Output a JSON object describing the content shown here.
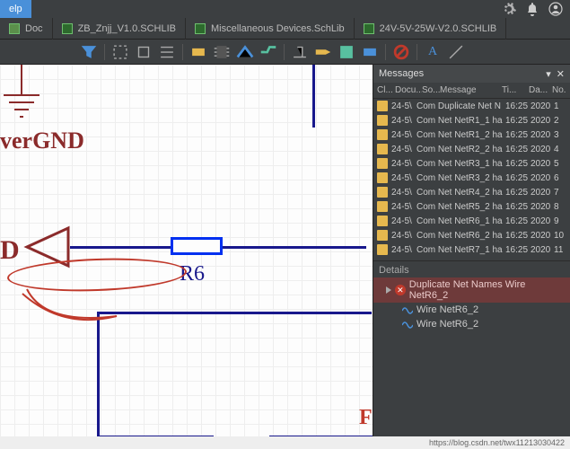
{
  "menu": {
    "help": "elp"
  },
  "tabs": [
    {
      "label": "Doc"
    },
    {
      "label": "ZB_Znjj_V1.0.SCHLIB"
    },
    {
      "label": "Miscellaneous Devices.SchLib"
    },
    {
      "label": "24V-5V-25W-V2.0.SCHLIB"
    }
  ],
  "schematic": {
    "label_gnd": "verGND",
    "label_d": "D",
    "label_r6": "R6",
    "label_f_cut": "F"
  },
  "messages": {
    "title": "Messages",
    "columns": {
      "cls": "Cl...",
      "doc": "Docu...",
      "src": "So...",
      "msg": "Message",
      "time": "Ti...",
      "date": "Da...",
      "no": "No."
    },
    "rows": [
      {
        "src": "24-5\\",
        "pre": "Com ",
        "msg": "Duplicate Net N",
        "ti": "16:25",
        "da": "2020",
        "no": "1"
      },
      {
        "src": "24-5\\",
        "pre": "Com ",
        "msg": "Net NetR1_1 ha",
        "ti": "16:25",
        "da": "2020",
        "no": "2"
      },
      {
        "src": "24-5\\",
        "pre": "Com ",
        "msg": "Net NetR1_2 ha",
        "ti": "16:25",
        "da": "2020",
        "no": "3"
      },
      {
        "src": "24-5\\",
        "pre": "Com ",
        "msg": "Net NetR2_2 ha",
        "ti": "16:25",
        "da": "2020",
        "no": "4"
      },
      {
        "src": "24-5\\",
        "pre": "Com ",
        "msg": "Net NetR3_1 ha",
        "ti": "16:25",
        "da": "2020",
        "no": "5"
      },
      {
        "src": "24-5\\",
        "pre": "Com ",
        "msg": "Net NetR3_2 ha",
        "ti": "16:25",
        "da": "2020",
        "no": "6"
      },
      {
        "src": "24-5\\",
        "pre": "Com ",
        "msg": "Net NetR4_2 ha",
        "ti": "16:25",
        "da": "2020",
        "no": "7"
      },
      {
        "src": "24-5\\",
        "pre": "Com ",
        "msg": "Net NetR5_2 ha",
        "ti": "16:25",
        "da": "2020",
        "no": "8"
      },
      {
        "src": "24-5\\",
        "pre": "Com ",
        "msg": "Net NetR6_1 ha",
        "ti": "16:25",
        "da": "2020",
        "no": "9"
      },
      {
        "src": "24-5\\",
        "pre": "Com ",
        "msg": "Net NetR6_2 ha",
        "ti": "16:25",
        "da": "2020",
        "no": "10"
      },
      {
        "src": "24-5\\",
        "pre": "Com ",
        "msg": "Net NetR7_1 ha",
        "ti": "16:25",
        "da": "2020",
        "no": "11"
      }
    ],
    "details_label": "Details",
    "details": {
      "error": "Duplicate Net Names Wire NetR6_2",
      "wire1": "Wire NetR6_2",
      "wire2": "Wire NetR6_2"
    }
  },
  "status": {
    "url": "https://blog.csdn.net/twx11213030422"
  }
}
